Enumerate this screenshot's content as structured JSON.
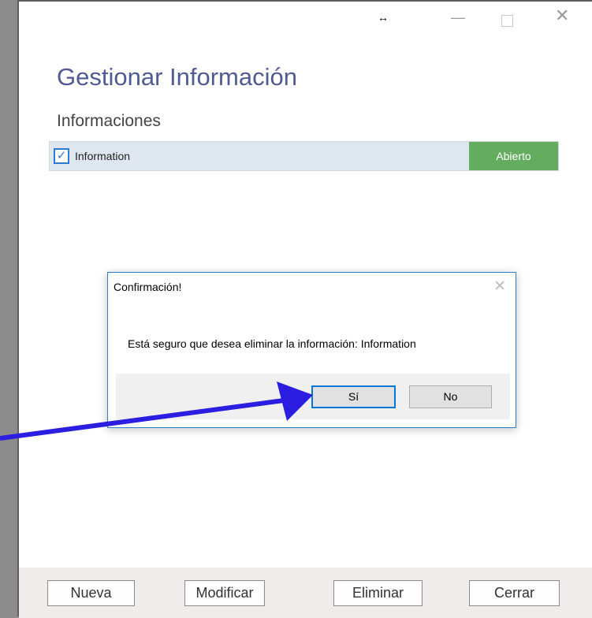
{
  "window": {
    "resize_glyph": "↔",
    "minimize_glyph": "—",
    "close_glyph": "✕",
    "title": "Gestionar Información",
    "subtitle": "Informaciones"
  },
  "list": {
    "items": [
      {
        "checked": true,
        "check_glyph": "✓",
        "label": "Information",
        "status": "Abierto"
      }
    ]
  },
  "footer": {
    "new_label": "Nueva",
    "edit_label": "Modificar",
    "delete_label": "Eliminar",
    "close_label": "Cerrar"
  },
  "dialog": {
    "title": "Confirmación!",
    "close_glyph": "✕",
    "message": "Está seguro que desea eliminar la información: Information",
    "yes_label": "Sí",
    "no_label": "No"
  },
  "colors": {
    "title": "#4f5b93",
    "status_open": "#64ad5f",
    "row_bg": "#dee6f0",
    "annotation_arrow": "#2b1ee0"
  }
}
